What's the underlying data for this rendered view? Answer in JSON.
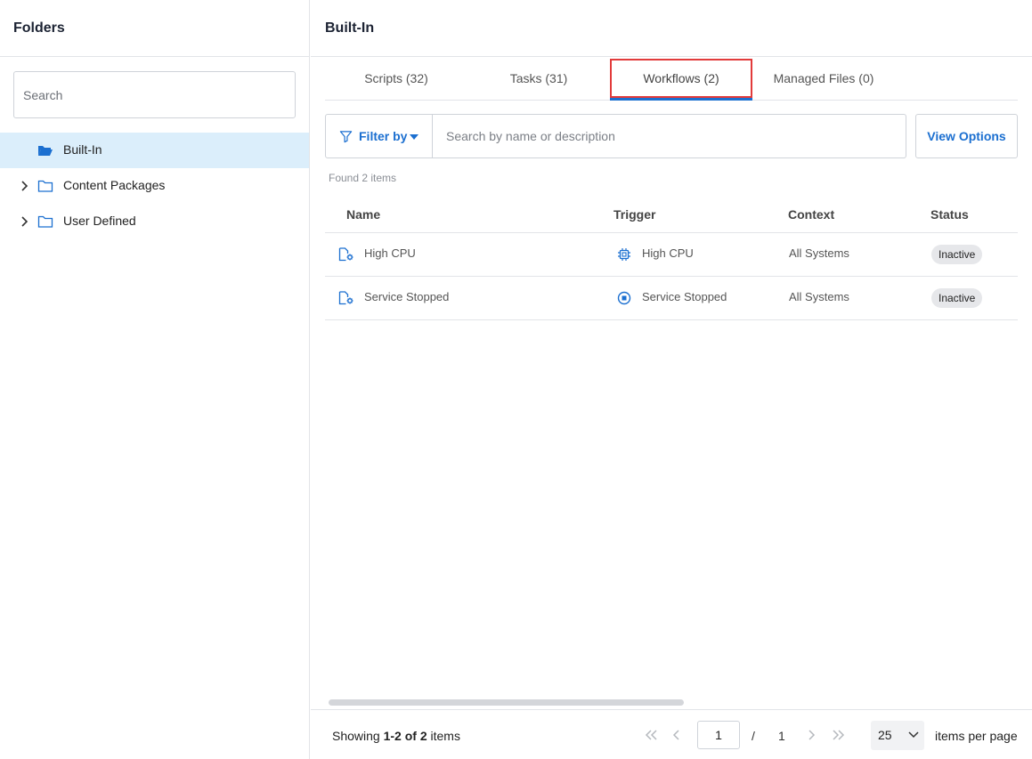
{
  "sidebar": {
    "title": "Folders",
    "search_placeholder": "Search",
    "items": [
      {
        "label": "Built-In"
      },
      {
        "label": "Content Packages"
      },
      {
        "label": "User Defined"
      }
    ]
  },
  "main": {
    "title": "Built-In",
    "tabs": [
      {
        "label": "Scripts (32)"
      },
      {
        "label": "Tasks (31)"
      },
      {
        "label": "Workflows (2)"
      },
      {
        "label": "Managed Files (0)"
      }
    ],
    "filter_label": "Filter by",
    "search_placeholder": "Search by name or description",
    "view_options_label": "View Options",
    "found_text": "Found 2 items"
  },
  "table": {
    "headers": {
      "name": "Name",
      "trigger": "Trigger",
      "context": "Context",
      "status": "Status"
    },
    "rows": [
      {
        "name": "High CPU",
        "trigger": "High CPU",
        "context": "All Systems",
        "status": "Inactive"
      },
      {
        "name": "Service Stopped",
        "trigger": "Service Stopped",
        "context": "All Systems",
        "status": "Inactive"
      }
    ]
  },
  "footer": {
    "showing_prefix": "Showing ",
    "showing_range": "1-2 of 2",
    "showing_suffix": " items",
    "current_page": "1",
    "separator": "/",
    "total_pages": "1",
    "per_page": "25",
    "per_page_label": "items per page"
  },
  "colors": {
    "accent": "#1b6fd0",
    "selected_bg": "#dbeefb",
    "highlight_border": "#e23b3b"
  }
}
